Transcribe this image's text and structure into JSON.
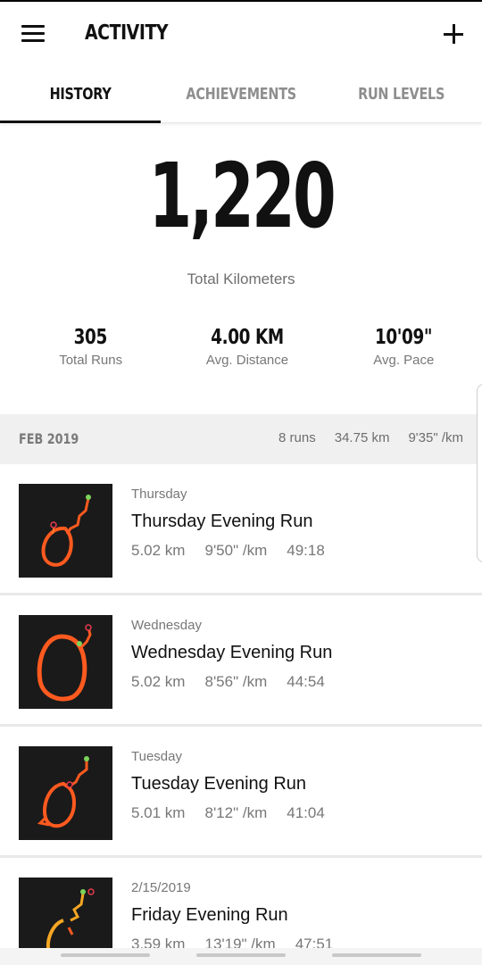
{
  "header": {
    "title": "ACTIVITY"
  },
  "tabs": [
    {
      "label": "HISTORY",
      "active": true
    },
    {
      "label": "ACHIEVEMENTS",
      "active": false
    },
    {
      "label": "RUN LEVELS",
      "active": false
    }
  ],
  "summary": {
    "total": "1,220",
    "total_label": "Total Kilometers",
    "stats": [
      {
        "value": "305",
        "label": "Total Runs"
      },
      {
        "value": "4.00 KM",
        "label": "Avg. Distance"
      },
      {
        "value": "10'09\"",
        "label": "Avg. Pace"
      }
    ]
  },
  "month": {
    "name": "FEB 2019",
    "runs": "8 runs",
    "distance": "34.75 km",
    "pace": "9'35\" /km"
  },
  "runs": [
    {
      "day": "Thursday",
      "title": "Thursday Evening Run",
      "distance": "5.02 km",
      "pace": "9'50\" /km",
      "time": "49:18"
    },
    {
      "day": "Wednesday",
      "title": "Wednesday Evening Run",
      "distance": "5.02 km",
      "pace": "8'56\" /km",
      "time": "44:54"
    },
    {
      "day": "Tuesday",
      "title": "Tuesday Evening Run",
      "distance": "5.01 km",
      "pace": "8'12\" /km",
      "time": "41:04"
    },
    {
      "day": "2/15/2019",
      "title": "Friday Evening Run",
      "distance": "3.59 km",
      "pace": "13'19\" /km",
      "time": "47:51"
    }
  ],
  "colors": {
    "route": "#ff5a1f",
    "start": "#7cd35a",
    "end": "#e83a4c",
    "thumb_bg": "#1a1a1a"
  },
  "icons": {
    "menu": "hamburger-icon",
    "add": "plus-icon"
  }
}
